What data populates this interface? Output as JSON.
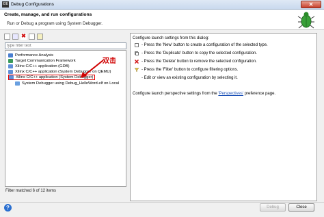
{
  "window": {
    "title": "Debug Configurations",
    "close_glyph": "✕",
    "app_icon": "IDE"
  },
  "header": {
    "title": "Create, manage, and run configurations",
    "subtitle": "Run or Debug a program using System Debugger."
  },
  "toolbar": {
    "delete_glyph": "✖"
  },
  "filter": {
    "placeholder": "type filter text",
    "status": "Filter matched 6 of 12 items"
  },
  "tree": {
    "items": [
      {
        "label": "Performance Analysis",
        "icon_color": "#4a7fd0"
      },
      {
        "label": "Target Communication Framework",
        "icon_color": "#3a9a5a"
      },
      {
        "label": "Xilinx C/C++ application (GDB)",
        "icon_color": "#5f8fd8"
      },
      {
        "label": "Xilinx C/C++ application (System Debugger on QEMU)",
        "icon_color": "#5f8fd8"
      },
      {
        "label": "Xilinx C/C++ application (System Debugger)",
        "icon_color": "#5f8fd8"
      },
      {
        "label": "System Debugger using Debug_HelloWord.elf on Local",
        "icon_color": "#6aa0e0"
      }
    ]
  },
  "annotation": {
    "text": "双击",
    "color": "#d00000"
  },
  "right": {
    "intro": "Configure launch settings from this dialog:",
    "lines": [
      "- Press the 'New' button to create a configuration of the selected type.",
      "- Press the 'Duplicate' button to copy the selected configuration.",
      "- Press the 'Delete' button to remove the selected configuration.",
      "- Press the 'Filter' button to configure filtering options.",
      "- Edit or view an existing configuration by selecting it."
    ],
    "perspective_prefix": "Configure launch perspective settings from the ",
    "perspective_link": "'Perspectives'",
    "perspective_suffix": " preference page."
  },
  "buttons": {
    "debug": "Debug",
    "close": "Close",
    "help": "?"
  }
}
